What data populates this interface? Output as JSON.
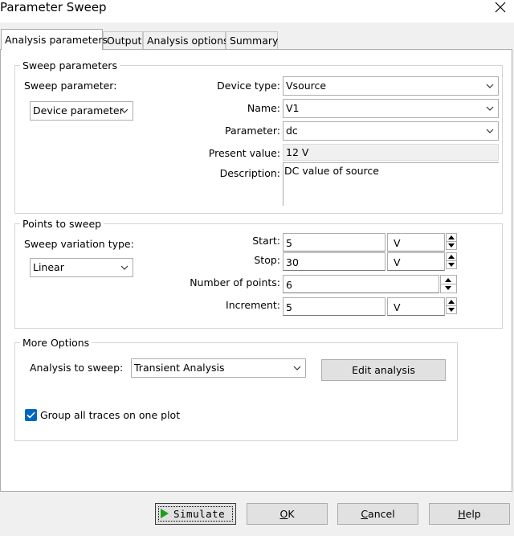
{
  "window": {
    "title": "Parameter Sweep"
  },
  "tabs": [
    {
      "label": "Analysis parameters",
      "active": true
    },
    {
      "label": "Output"
    },
    {
      "label": "Analysis options"
    },
    {
      "label": "Summary"
    }
  ],
  "sweep_parameters": {
    "legend": "Sweep parameters",
    "sweep_parameter_label": "Sweep parameter:",
    "sweep_parameter_value": "Device parameter",
    "device_type_label": "Device type:",
    "device_type_value": "Vsource",
    "name_label": "Name:",
    "name_value": "V1",
    "parameter_label": "Parameter:",
    "parameter_value": "dc",
    "present_value_label": "Present value:",
    "present_value": "12 V",
    "description_label": "Description:",
    "description_value": "DC value of source"
  },
  "points_to_sweep": {
    "legend": "Points to sweep",
    "variation_type_label": "Sweep variation type:",
    "variation_type_value": "Linear",
    "start_label": "Start:",
    "start_value": "5",
    "start_unit": "V",
    "stop_label": "Stop:",
    "stop_value": "30",
    "stop_unit": "V",
    "num_points_label": "Number of points:",
    "num_points_value": "6",
    "increment_label": "Increment:",
    "increment_value": "5",
    "increment_unit": "V"
  },
  "more_options": {
    "legend": "More Options",
    "analysis_to_sweep_label": "Analysis to sweep:",
    "analysis_to_sweep_value": "Transient Analysis",
    "edit_analysis_label": "Edit analysis",
    "group_traces_label": "Group all traces on one plot",
    "group_traces_checked": true
  },
  "buttons": {
    "simulate": "Simulate",
    "ok_mnemonic": "O",
    "ok_rest": "K",
    "cancel_mnemonic": "C",
    "cancel_rest": "ancel",
    "help_mnemonic": "H",
    "help_rest": "elp"
  },
  "colors": {
    "accent": "#0067c0",
    "play_green": "#1e9e1e",
    "default_border": "#0078d7"
  }
}
